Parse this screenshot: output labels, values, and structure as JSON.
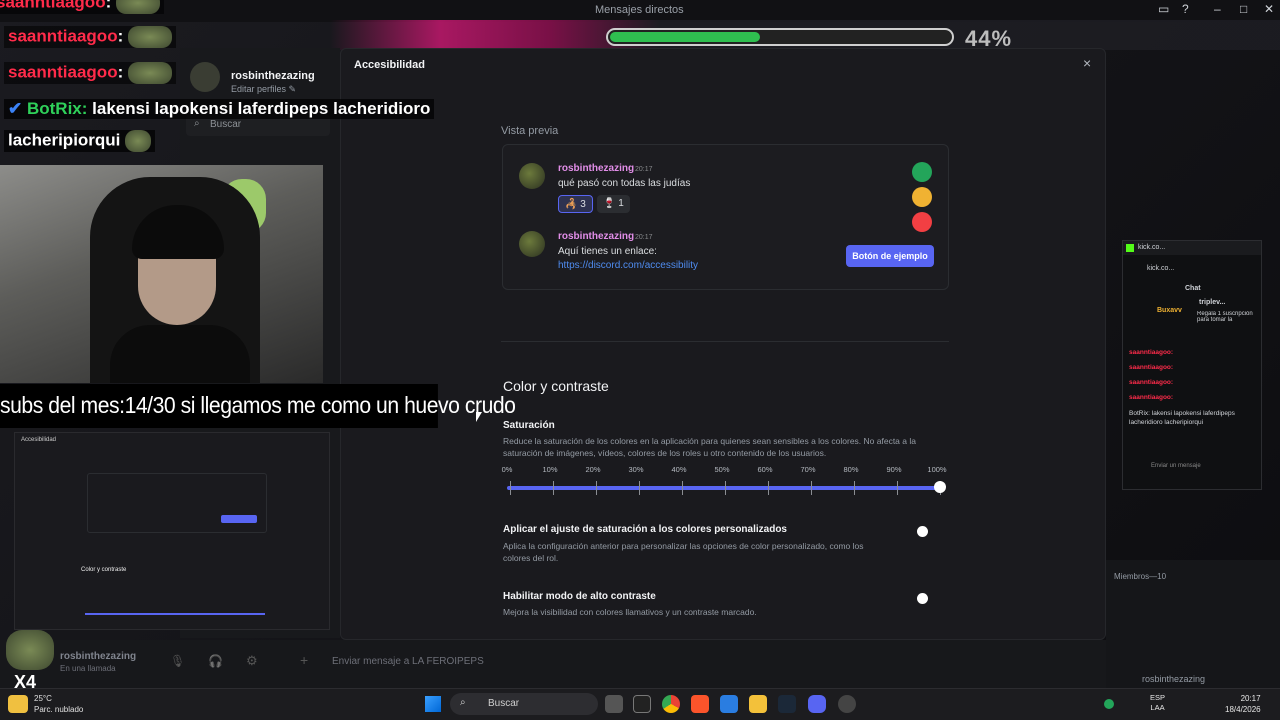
{
  "discord": {
    "window_title": "Mensajes directos",
    "profile_name": "rosbinthezazing",
    "edit_profiles": "Editar perfiles",
    "search_placeholder": "Buscar",
    "bottom_user": "rosbinthezazing",
    "bottom_status": "En una llamada",
    "message_placeholder": "Enviar mensaje a LA FEROIPEPS"
  },
  "stream_progress": {
    "percent_label": "44%",
    "fraction": 0.44
  },
  "modal": {
    "title": "Accesibilidad",
    "close_label": "×",
    "preview_label": "Vista previa",
    "messages": [
      {
        "user": "rosbinthezazing",
        "time": "20:17",
        "text": "qué pasó con todas las judías",
        "reactions": [
          {
            "emoji": "🦂",
            "count": "3"
          },
          {
            "emoji": "🍷",
            "count": "1"
          }
        ]
      },
      {
        "user": "rosbinthezazing",
        "time": "20:17",
        "text": "Aquí tienes un enlace:",
        "link": "https://discord.com/accessibility"
      }
    ],
    "sample_button": "Botón de ejemplo",
    "section_title": "Color y contraste",
    "saturation": {
      "title": "Saturación",
      "desc": "Reduce la saturación de los colores en la aplicación para quienes sean sensibles a los colores. No afecta a la saturación de imágenes, vídeos, colores de los roles u otro contenido de los usuarios.",
      "ticks": [
        "0%",
        "10%",
        "20%",
        "30%",
        "40%",
        "50%",
        "60%",
        "70%",
        "80%",
        "90%",
        "100%"
      ],
      "value": 1.0
    },
    "custom_colors": {
      "title": "Aplicar el ajuste de saturación a los colores personalizados",
      "desc": "Aplica la configuración anterior para personalizar las opciones de color personalizado, como los colores del rol.",
      "enabled": false
    },
    "high_contrast": {
      "title": "Habilitar modo de alto contraste",
      "desc": "Mejora la visibilidad con colores llamativos y un contraste marcado.",
      "enabled": false
    }
  },
  "overlay": {
    "chat": [
      {
        "user": "saanntiaagoo",
        "sep": ":"
      },
      {
        "user": "saanntiaagoo",
        "sep": ":"
      },
      {
        "user": "saanntiaagoo",
        "sep": ":"
      }
    ],
    "botrix_user": "BotRix:",
    "botrix_text": "lakensi lapokensi laferdipeps lacheridioro",
    "botrix_text2": "lacheripiorqui",
    "subs_banner": "subs del mes:14/30 si llegamos me como un huevo crudo",
    "x4": "X4"
  },
  "kick": {
    "title": "kick.co...",
    "url": "kick.co...",
    "chat_label": "Chat",
    "top_user": "triplev...",
    "sub_user": "Buxavv",
    "sub_text": "Regala 1 suscripción para tomar la",
    "lines": [
      "saanntiaagoo:",
      "saanntiaagoo:",
      "saanntiaagoo:",
      "saanntiaagoo:"
    ],
    "botrix": "BotRix: lakensi lapokensi laferdipeps lacheridioro lacheripiorqui",
    "send_placeholder": "Enviar un mensaje"
  },
  "members": {
    "header": "Miembros—10",
    "member": "rosbinthezazing"
  },
  "taskbar": {
    "weather_temp": "25°C",
    "weather_desc": "Parc. nublado",
    "search": "Buscar",
    "lang1": "ESP",
    "lang2": "LAA",
    "time": "20:17",
    "date": "18/4/2026"
  },
  "colors": {
    "accent": "#5865f2",
    "link": "#4f8cf0",
    "username": "#e28ee8",
    "chat_user": "#ff2b4a",
    "progress": "#2fbf50"
  }
}
